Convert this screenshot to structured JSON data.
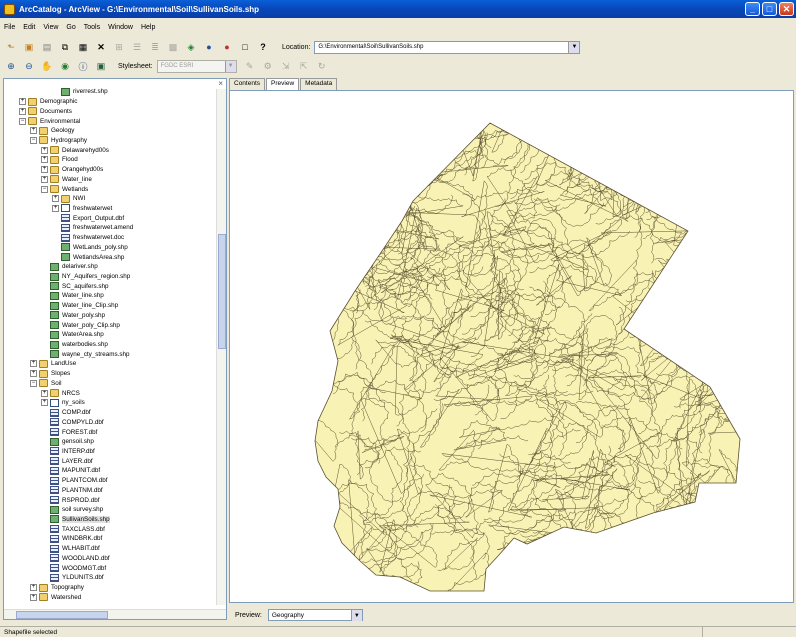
{
  "window": {
    "title": "ArcCatalog - ArcView - G:\\Environmental\\Soil\\SullivanSoils.shp",
    "buttons": {
      "minimize": "_",
      "maximize": "□",
      "close": "✕"
    }
  },
  "menu": [
    "File",
    "Edit",
    "View",
    "Go",
    "Tools",
    "Window",
    "Help"
  ],
  "toolbar": {
    "location_label": "Location:",
    "location_value": "G:\\Environmental\\Soil\\SullivanSoils.shp",
    "stylesheet_label": "Stylesheet:",
    "stylesheet_value": "FGDC ESRI"
  },
  "tree": {
    "items": [
      {
        "label": "riverrest.shp",
        "level": 4,
        "icon": "shp",
        "exp": ""
      },
      {
        "label": "Demographic",
        "level": 1,
        "icon": "folder",
        "exp": "+"
      },
      {
        "label": "Documents",
        "level": 1,
        "icon": "folder",
        "exp": "+"
      },
      {
        "label": "Environmental",
        "level": 1,
        "icon": "folder",
        "exp": "-"
      },
      {
        "label": "Geology",
        "level": 2,
        "icon": "folder",
        "exp": "+"
      },
      {
        "label": "Hydrography",
        "level": 2,
        "icon": "folder",
        "exp": "-"
      },
      {
        "label": "Delawarehyd00s",
        "level": 3,
        "icon": "folder",
        "exp": "+"
      },
      {
        "label": "Flood",
        "level": 3,
        "icon": "folder",
        "exp": "+"
      },
      {
        "label": "Orangehyd00s",
        "level": 3,
        "icon": "folder",
        "exp": "+"
      },
      {
        "label": "Water_line",
        "level": 3,
        "icon": "folder",
        "exp": "+"
      },
      {
        "label": "Wetlands",
        "level": 3,
        "icon": "folder",
        "exp": "-"
      },
      {
        "label": "NWI",
        "level": 4,
        "icon": "folder",
        "exp": "+"
      },
      {
        "label": "freshwaterwet",
        "level": 4,
        "icon": "link",
        "exp": "+"
      },
      {
        "label": "Export_Output.dbf",
        "level": 4,
        "icon": "dbf",
        "exp": ""
      },
      {
        "label": "freshwaterwet.amend",
        "level": 4,
        "icon": "dbf",
        "exp": ""
      },
      {
        "label": "freshwaterwet.doc",
        "level": 4,
        "icon": "dbf",
        "exp": ""
      },
      {
        "label": "WetLands_poly.shp",
        "level": 4,
        "icon": "shp",
        "exp": ""
      },
      {
        "label": "WetlandsArea.shp",
        "level": 4,
        "icon": "shp",
        "exp": ""
      },
      {
        "label": "delariver.shp",
        "level": 3,
        "icon": "shp",
        "exp": ""
      },
      {
        "label": "NY_Aquifers_region.shp",
        "level": 3,
        "icon": "shp",
        "exp": ""
      },
      {
        "label": "SC_aquifers.shp",
        "level": 3,
        "icon": "shp",
        "exp": ""
      },
      {
        "label": "Water_line.shp",
        "level": 3,
        "icon": "shp",
        "exp": ""
      },
      {
        "label": "Water_line_Clip.shp",
        "level": 3,
        "icon": "shp",
        "exp": ""
      },
      {
        "label": "Water_poly.shp",
        "level": 3,
        "icon": "shp",
        "exp": ""
      },
      {
        "label": "Water_poly_Clip.shp",
        "level": 3,
        "icon": "shp",
        "exp": ""
      },
      {
        "label": "WaterArea.shp",
        "level": 3,
        "icon": "shp",
        "exp": ""
      },
      {
        "label": "waterbodies.shp",
        "level": 3,
        "icon": "shp",
        "exp": ""
      },
      {
        "label": "wayne_cty_streams.shp",
        "level": 3,
        "icon": "shp",
        "exp": ""
      },
      {
        "label": "LandUse",
        "level": 2,
        "icon": "folder",
        "exp": "+"
      },
      {
        "label": "Slopes",
        "level": 2,
        "icon": "folder",
        "exp": "+"
      },
      {
        "label": "Soil",
        "level": 2,
        "icon": "folder",
        "exp": "-"
      },
      {
        "label": "NRCS",
        "level": 3,
        "icon": "folder",
        "exp": "+"
      },
      {
        "label": "ny_soils",
        "level": 3,
        "icon": "link",
        "exp": "+"
      },
      {
        "label": "COMP.dbf",
        "level": 3,
        "icon": "dbf",
        "exp": ""
      },
      {
        "label": "COMPYLD.dbf",
        "level": 3,
        "icon": "dbf",
        "exp": ""
      },
      {
        "label": "FOREST.dbf",
        "level": 3,
        "icon": "dbf",
        "exp": ""
      },
      {
        "label": "gensoil.shp",
        "level": 3,
        "icon": "shp",
        "exp": ""
      },
      {
        "label": "INTERP.dbf",
        "level": 3,
        "icon": "dbf",
        "exp": ""
      },
      {
        "label": "LAYER.dbf",
        "level": 3,
        "icon": "dbf",
        "exp": ""
      },
      {
        "label": "MAPUNIT.dbf",
        "level": 3,
        "icon": "dbf",
        "exp": ""
      },
      {
        "label": "PLANTCOM.dbf",
        "level": 3,
        "icon": "dbf",
        "exp": ""
      },
      {
        "label": "PLANTNM.dbf",
        "level": 3,
        "icon": "dbf",
        "exp": ""
      },
      {
        "label": "RSPROD.dbf",
        "level": 3,
        "icon": "dbf",
        "exp": ""
      },
      {
        "label": "soil survey.shp",
        "level": 3,
        "icon": "shp",
        "exp": ""
      },
      {
        "label": "SullivanSoils.shp",
        "level": 3,
        "icon": "shp",
        "exp": "",
        "selected": true
      },
      {
        "label": "TAXCLASS.dbf",
        "level": 3,
        "icon": "dbf",
        "exp": ""
      },
      {
        "label": "WINDBRK.dbf",
        "level": 3,
        "icon": "dbf",
        "exp": ""
      },
      {
        "label": "WLHABIT.dbf",
        "level": 3,
        "icon": "dbf",
        "exp": ""
      },
      {
        "label": "WOODLAND.dbf",
        "level": 3,
        "icon": "dbf",
        "exp": ""
      },
      {
        "label": "WOODMGT.dbf",
        "level": 3,
        "icon": "dbf",
        "exp": ""
      },
      {
        "label": "YLDUNITS.dbf",
        "level": 3,
        "icon": "dbf",
        "exp": ""
      },
      {
        "label": "Topography",
        "level": 2,
        "icon": "folder",
        "exp": "+"
      },
      {
        "label": "Watershed",
        "level": 2,
        "icon": "folder",
        "exp": "+"
      }
    ]
  },
  "tabs": [
    {
      "label": "Contents",
      "active": false
    },
    {
      "label": "Preview",
      "active": true
    },
    {
      "label": "Metadata",
      "active": false
    }
  ],
  "preview": {
    "label": "Preview:",
    "value": "Geography",
    "fill_color": "#f8f2b4",
    "line_color": "#5a5030"
  },
  "status": "Shapefile selected"
}
